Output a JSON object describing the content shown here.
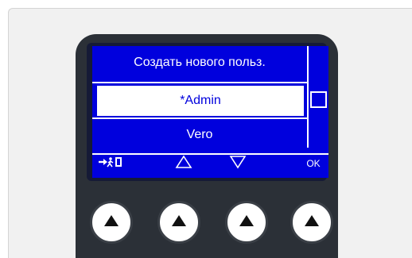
{
  "screen": {
    "header": "Создать нового польз.",
    "menu_items": [
      {
        "label": "*Admin",
        "selected": true
      },
      {
        "label": "Vero",
        "selected": false
      }
    ]
  },
  "softkeys": {
    "exit_icon": "exit-icon",
    "up_icon": "triangle-up-outline-icon",
    "down_icon": "triangle-down-outline-icon",
    "ok_label": "OK"
  },
  "hardware_buttons": [
    {
      "icon": "triangle-up-icon"
    },
    {
      "icon": "triangle-up-icon"
    },
    {
      "icon": "triangle-up-icon"
    },
    {
      "icon": "triangle-up-icon"
    }
  ],
  "colors": {
    "screen_bg": "#0000dd",
    "device_body": "#2b3037",
    "panel_bg": "#f1f1f1"
  }
}
